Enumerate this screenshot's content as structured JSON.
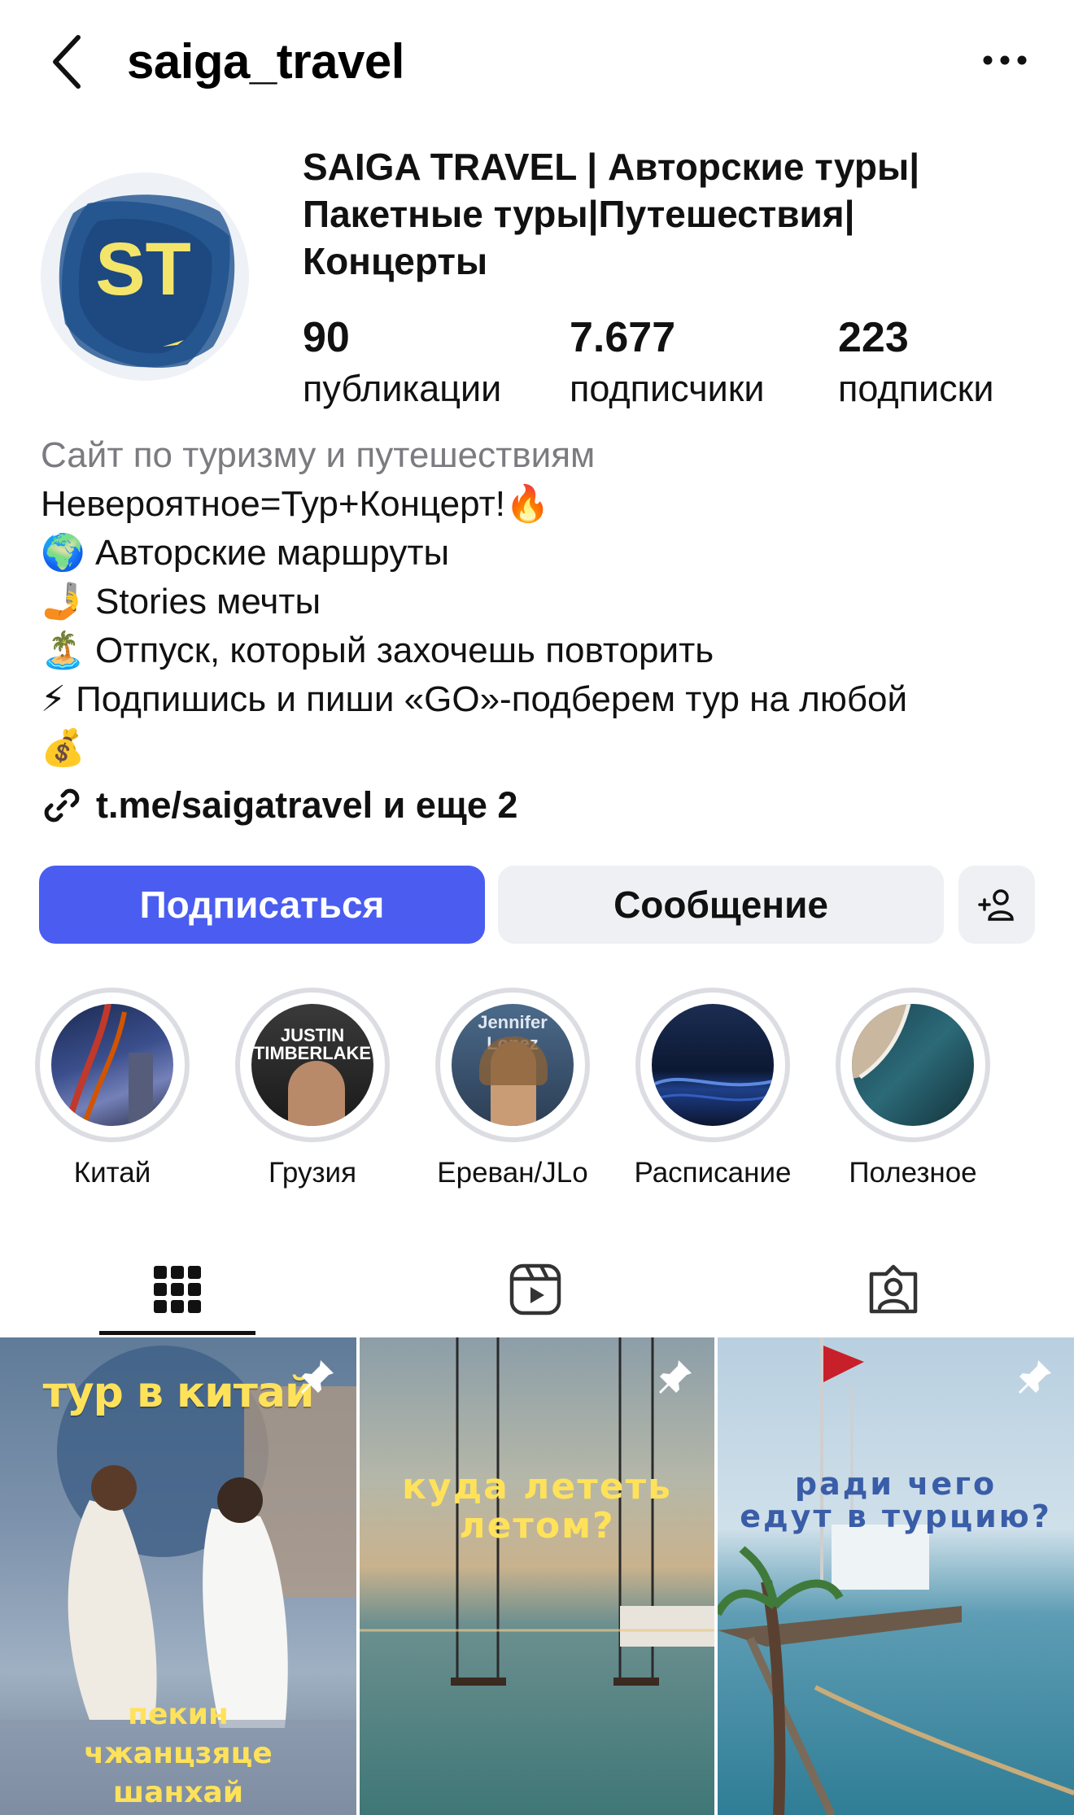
{
  "header": {
    "username": "saiga_travel",
    "back_icon": "chevron-left-icon",
    "more_icon": "ellipsis-icon"
  },
  "profile": {
    "avatar_text": "ST",
    "full_name_lines": [
      "SAIGA TRAVEL | Авторские туры|",
      "Пакетные туры|Путешествия|",
      "Концерты"
    ],
    "stats": [
      {
        "count": "90",
        "label": "публикации"
      },
      {
        "count": "7.677",
        "label": "подписчики"
      },
      {
        "count": "223",
        "label": "подписки"
      }
    ],
    "category": "Сайт по туризму и путешествиям",
    "bio_lines": [
      "Невероятное=Тур+Концерт!🔥",
      "🌍 Авторские маршруты",
      "🤳 Stories мечты",
      "🏝️ Отпуск, который захочешь повторить",
      "⚡ Подпишись и пиши «GO»-подберем тур на любой",
      "💰"
    ],
    "link": "t.me/saigatravel и еще 2"
  },
  "actions": {
    "follow": "Подписаться",
    "message": "Сообщение",
    "add_user_icon": "add-user-icon"
  },
  "highlights": [
    {
      "label": "Китай"
    },
    {
      "label": "Грузия",
      "overlay": "JUSTIN TIMBERLAKE"
    },
    {
      "label": "Ереван/JLo",
      "overlay": "Jennifer Lopez"
    },
    {
      "label": "Расписание"
    },
    {
      "label": "Полезное"
    }
  ],
  "tabs": [
    {
      "name": "grid",
      "icon": "grid-icon",
      "active": true
    },
    {
      "name": "reels",
      "icon": "reels-icon",
      "active": false
    },
    {
      "name": "tagged",
      "icon": "tagged-icon",
      "active": false
    }
  ],
  "posts": [
    {
      "title": "тур в китай",
      "subtitle_lines": [
        "пекин",
        "чжанцзяце",
        "шанхай"
      ],
      "pinned": true
    },
    {
      "title_lines": [
        "куда лететь",
        "летом?"
      ],
      "pinned": true
    },
    {
      "title_lines": [
        "ради чего",
        "едут в турцию?"
      ],
      "pinned": true
    }
  ],
  "colors": {
    "accent": "#4a5df0",
    "avatar_bg": "#1c4f8a",
    "avatar_text": "#f3e56a"
  }
}
